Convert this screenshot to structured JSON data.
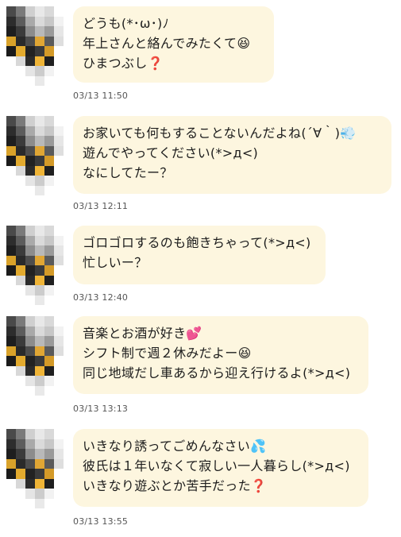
{
  "messages": [
    {
      "lines": [
        "どうも(*･ω･)ﾉ",
        "年上さんと絡んでみたくて😆",
        "ひまつぶし❓"
      ],
      "time": "03/13 11:50"
    },
    {
      "lines": [
        "お家いても何もすることないんだよね(´∀｀)💨",
        "遊んでやってください(*>д<)",
        "なにしてたー？"
      ],
      "time": "03/13 12:11"
    },
    {
      "lines": [
        "ゴロゴロするのも飽きちゃって(*>д<)",
        "忙しいー？"
      ],
      "time": "03/13 12:40"
    },
    {
      "lines": [
        "音楽とお酒が好き💕",
        "シフト制で週２休みだよー😆",
        "同じ地域だし車あるから迎え行けるよ(*>д<)"
      ],
      "time": "03/13 13:13"
    },
    {
      "lines": [
        "いきなり誘ってごめんなさい💦",
        "彼氏は１年いなくて寂しい一人暮らし(*>д<)",
        "いきなり遊ぶとか苦手だった❓"
      ],
      "time": "03/13 13:55"
    }
  ],
  "colors": {
    "bubble": "#fdf6df",
    "text": "#1c1c1c",
    "timestamp": "#555555"
  }
}
